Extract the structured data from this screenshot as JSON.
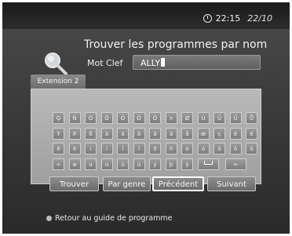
{
  "status": {
    "time": "22:15",
    "date": "22/10"
  },
  "header": {
    "title": "Trouver les programmes par nom",
    "keyword_label": "Mot Clef",
    "keyword_value": "ALLY"
  },
  "tab": {
    "label": "Extension 2"
  },
  "keyboard": {
    "rows": [
      [
        "Ģ",
        "Ñ",
        "Ó",
        "Ö",
        "Ő",
        "Ō",
        "Ö",
        "×",
        "Ø",
        "Ú",
        "Ü",
        "Ű",
        "Ů"
      ],
      [
        "Ý",
        "Þ",
        "ß",
        "à",
        "á",
        "â",
        "ã",
        "ä",
        "å",
        "æ",
        "ç",
        "è",
        "é"
      ],
      [
        "ê",
        "ë",
        "ì",
        "í",
        "î",
        "ï",
        "ð",
        "ñ",
        "ò",
        "ó",
        "ô",
        "õ",
        "ö"
      ],
      [
        "÷",
        "ø",
        "ù",
        "ú",
        "û",
        "ü",
        "ý",
        "þ",
        "ÿ",
        "␣",
        "←"
      ]
    ]
  },
  "buttons": {
    "find": "Trouver",
    "by_genre": "Par genre",
    "previous": "Précédent",
    "next": "Suivant"
  },
  "footer": {
    "back_label": "Retour au guide de programme"
  }
}
